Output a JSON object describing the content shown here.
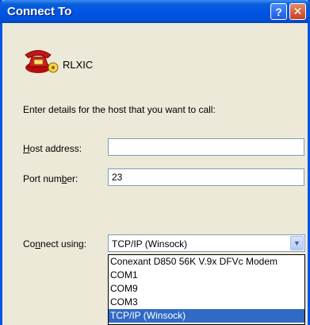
{
  "window": {
    "title": "Connect To",
    "help_glyph": "?",
    "close_glyph": "✕"
  },
  "connection": {
    "name": "RLXIC",
    "icon": "phone-icon"
  },
  "form": {
    "prompt": "Enter details for the host that you want to call:",
    "host_address": {
      "label_pre": "",
      "label_key": "H",
      "label_post": "ost address:",
      "value": ""
    },
    "port_number": {
      "label_pre": "Port num",
      "label_key": "b",
      "label_post": "er:",
      "value": "23"
    },
    "connect_using": {
      "label_pre": "Co",
      "label_key": "n",
      "label_post": "nect using:",
      "value": "TCP/IP (Winsock)",
      "arrow": "▼",
      "options": [
        "Conexant D850 56K V.9x DFVc Modem",
        "COM1",
        "COM9",
        "COM3",
        "TCP/IP (Winsock)"
      ],
      "selected_index": 4
    }
  },
  "colors": {
    "title_bar": "#0055e5",
    "selection": "#316ac5",
    "dialog_bg": "#ece9d8"
  }
}
